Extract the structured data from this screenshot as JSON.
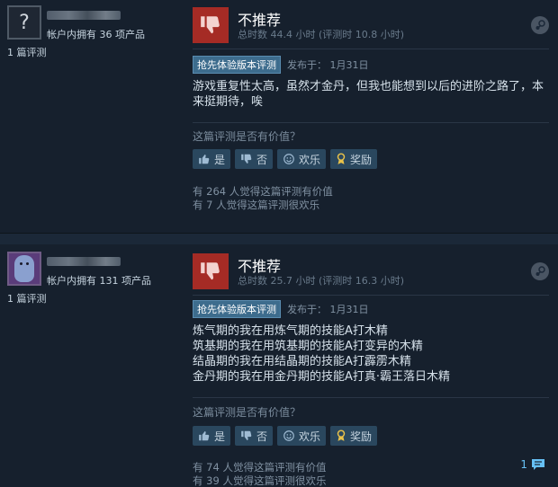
{
  "reviews": [
    {
      "owned": "帐户内拥有 36 项产品",
      "review_count": "1 篇评测",
      "verdict": "不推荐",
      "hours": "总时数 44.4 小时  (评测时 10.8 小时)",
      "badge": "抢先体验版本评测",
      "posted": "发布于：  1月31日",
      "body": [
        "游戏重复性太高，虽然才金丹，但我也能想到以后的进阶之路了，本",
        "来挺期待，唉"
      ],
      "helpful_q": "这篇评测是否有价值？",
      "buttons": {
        "yes": "是",
        "no": "否",
        "funny": "欢乐",
        "award": "奖励"
      },
      "helpful_count": "有 264 人觉得这篇评测有价值",
      "funny_count": "有 7 人觉得这篇评测很欢乐"
    },
    {
      "owned": "帐户内拥有 131 项产品",
      "review_count": "1 篇评测",
      "verdict": "不推荐",
      "hours": "总时数 25.7 小时  (评测时 16.3 小时)",
      "badge": "抢先体验版本评测",
      "posted": "发布于：  1月31日",
      "body": [
        "炼气期的我在用炼气期的技能A打木精",
        "筑基期的我在用筑基期的技能A打变异的木精",
        "结晶期的我在用结晶期的技能A打霹雳木精",
        "金丹期的我在用金丹期的技能A打真·霸王落日木精"
      ],
      "helpful_q": "这篇评测是否有价值？",
      "buttons": {
        "yes": "是",
        "no": "否",
        "funny": "欢乐",
        "award": "奖励"
      },
      "helpful_count": "有 74 人觉得这篇评测有价值",
      "funny_count": "有 39 人觉得这篇评测很欢乐",
      "comments": "1"
    }
  ],
  "colors": {
    "background": "#1b2838",
    "panel": "#16202d",
    "thumb_down": "#a52b25",
    "button": "#2a475e",
    "badge": "#3d6c8d",
    "link": "#66c0f4"
  },
  "icons": {
    "thumb_down": "thumbs-down-icon",
    "steam": "steam-icon",
    "comment": "comment-icon"
  }
}
